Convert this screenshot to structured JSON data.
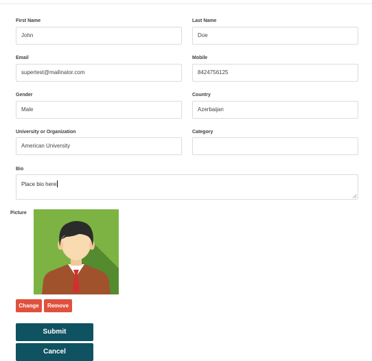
{
  "form": {
    "first_name": {
      "label": "First Name",
      "value": "John"
    },
    "last_name": {
      "label": "Last Name",
      "value": "Doe"
    },
    "email": {
      "label": "Email",
      "value": "supertest@mailinator.com"
    },
    "mobile": {
      "label": "Mobile",
      "value": "8424756125"
    },
    "gender": {
      "label": "Gender",
      "value": "Male"
    },
    "country": {
      "label": "Country",
      "value": "Azerbaijan"
    },
    "university": {
      "label": "University or Organization",
      "value": "American University"
    },
    "category": {
      "label": "Category",
      "value": ""
    },
    "bio": {
      "label": "Bio",
      "value": "Place bio here"
    },
    "picture": {
      "label": "Picture",
      "avatar_icon": "person-avatar-icon"
    }
  },
  "buttons": {
    "change": "Change",
    "remove": "Remove",
    "submit": "Submit",
    "cancel": "Cancel"
  },
  "colors": {
    "danger": "#e0513d",
    "primary": "#0f5261",
    "avatar_bg": "#7cb342"
  }
}
